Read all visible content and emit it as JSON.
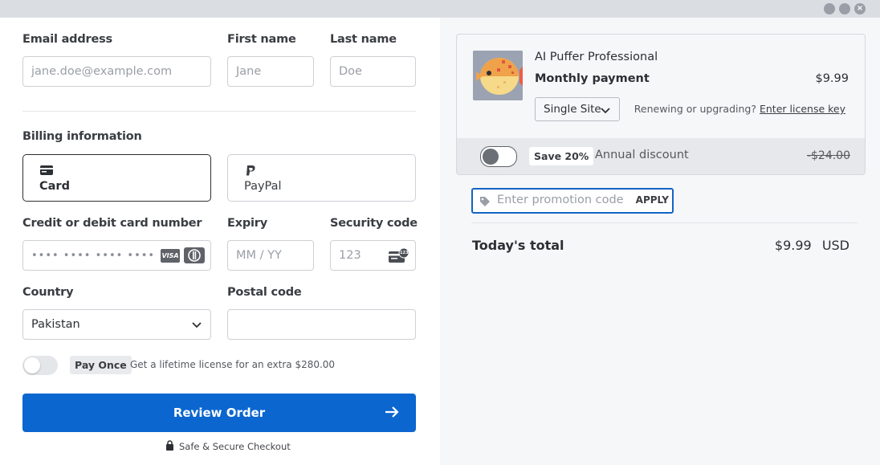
{
  "window": {
    "close_glyph": "×"
  },
  "form": {
    "email": {
      "label": "Email address",
      "placeholder": "jane.doe@example.com"
    },
    "first_name": {
      "label": "First name",
      "placeholder": "Jane"
    },
    "last_name": {
      "label": "Last name",
      "placeholder": "Doe"
    },
    "billing_heading": "Billing information",
    "methods": [
      {
        "label": "Card",
        "icon": "credit-card-icon"
      },
      {
        "label": "PayPal",
        "icon": "paypal-icon"
      }
    ],
    "card_number": {
      "label": "Credit or debit card number",
      "placeholder": "•••• •••• •••• ••••",
      "brands": [
        "VISA",
        "Diners"
      ]
    },
    "expiry": {
      "label": "Expiry",
      "placeholder": "MM / YY"
    },
    "security": {
      "label": "Security code",
      "placeholder": "123",
      "badge": "123"
    },
    "country": {
      "label": "Country",
      "value": "Pakistan"
    },
    "postal": {
      "label": "Postal code",
      "value": ""
    },
    "pay_once": {
      "pill": "Pay Once",
      "text": "Get a lifetime license for an extra $280.00",
      "enabled": false
    },
    "review_button": "Review Order",
    "secure_text": "Safe & Secure Checkout"
  },
  "summary": {
    "product_name": "AI Puffer Professional",
    "plan_label": "Monthly payment",
    "price": "$9.99",
    "site_option": "Single Site",
    "renew_text": "Renewing or upgrading?",
    "license_link": "Enter license key",
    "discount": {
      "badge": "Save 20%",
      "label": "Annual discount",
      "strike_price": "-$24.00",
      "enabled": false
    },
    "promo": {
      "placeholder": "Enter promotion code",
      "apply": "APPLY"
    },
    "total_label": "Today's total",
    "total_amount": "$9.99",
    "currency": "USD"
  },
  "colors": {
    "accent": "#0b66d0",
    "promo_border": "#1463c6"
  }
}
